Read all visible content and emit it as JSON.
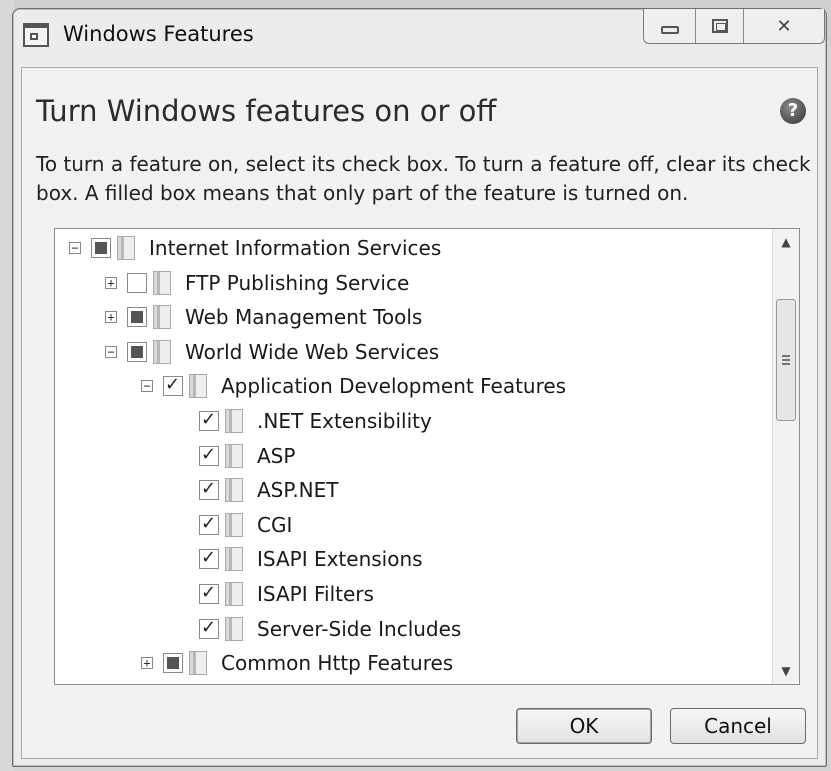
{
  "window": {
    "title": "Windows Features",
    "close_glyph": "✕"
  },
  "content": {
    "heading": "Turn Windows features on or off",
    "help_glyph": "?",
    "description": "To turn a feature on, select its check box. To turn a feature off, clear its check box. A filled box means that only part of the feature is turned on."
  },
  "tree": {
    "items": [
      {
        "label": "Internet Information Services",
        "expander": "−",
        "state": "partial"
      },
      {
        "label": "FTP Publishing Service",
        "expander": "+",
        "state": "unchecked"
      },
      {
        "label": "Web Management Tools",
        "expander": "+",
        "state": "partial"
      },
      {
        "label": "World Wide Web Services",
        "expander": "−",
        "state": "partial"
      },
      {
        "label": "Application Development Features",
        "expander": "−",
        "state": "checked"
      },
      {
        "label": ".NET Extensibility",
        "expander": "",
        "state": "checked"
      },
      {
        "label": "ASP",
        "expander": "",
        "state": "checked"
      },
      {
        "label": "ASP.NET",
        "expander": "",
        "state": "checked"
      },
      {
        "label": "CGI",
        "expander": "",
        "state": "checked"
      },
      {
        "label": "ISAPI Extensions",
        "expander": "",
        "state": "checked"
      },
      {
        "label": "ISAPI Filters",
        "expander": "",
        "state": "checked"
      },
      {
        "label": "Server-Side Includes",
        "expander": "",
        "state": "checked"
      },
      {
        "label": "Common Http Features",
        "expander": "+",
        "state": "partial"
      }
    ]
  },
  "scrollbar": {
    "up_glyph": "▲",
    "down_glyph": "▼"
  },
  "buttons": {
    "ok": "OK",
    "cancel": "Cancel"
  }
}
